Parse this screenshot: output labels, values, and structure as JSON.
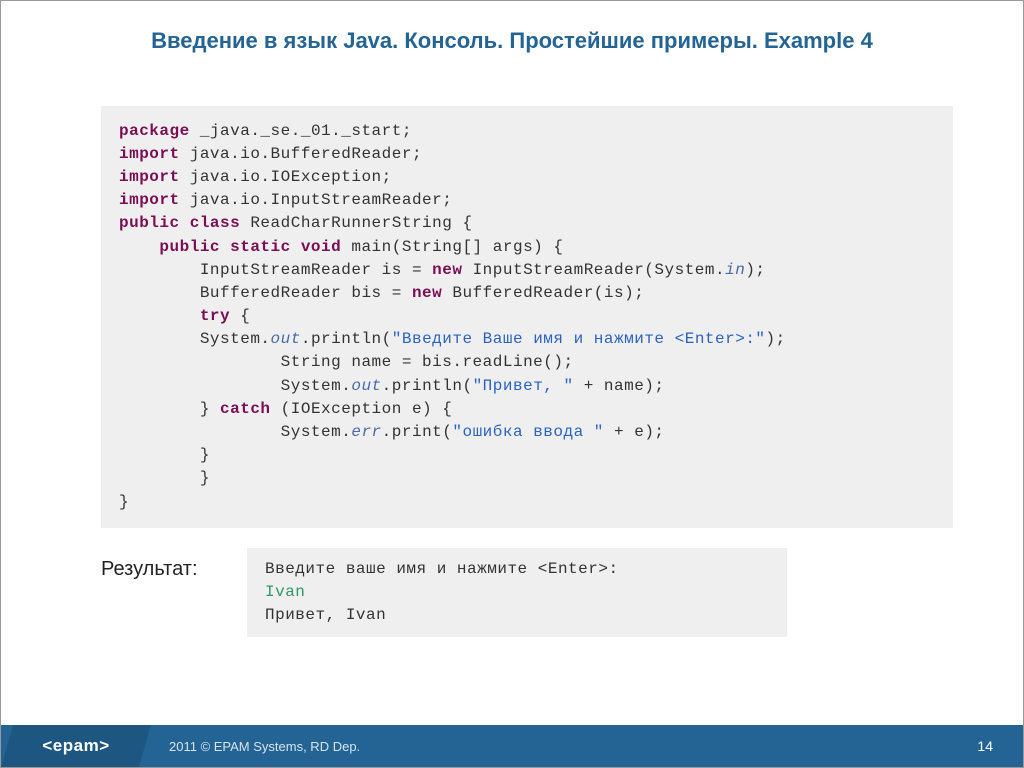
{
  "title": "Введение в язык Java. Консоль. Простейшие примеры. Example 4",
  "code": {
    "lines": [
      {
        "indent": 0,
        "tokens": [
          {
            "t": "package",
            "c": "kw"
          },
          {
            "t": " _java._se._01._start;"
          }
        ]
      },
      {
        "indent": 0,
        "tokens": [
          {
            "t": "import",
            "c": "kw"
          },
          {
            "t": " java.io.BufferedReader;"
          }
        ]
      },
      {
        "indent": 0,
        "tokens": [
          {
            "t": "import",
            "c": "kw"
          },
          {
            "t": " java.io.IOException;"
          }
        ]
      },
      {
        "indent": 0,
        "tokens": [
          {
            "t": "import",
            "c": "kw"
          },
          {
            "t": " java.io.InputStreamReader;"
          }
        ]
      },
      {
        "indent": 0,
        "tokens": [
          {
            "t": "public class",
            "c": "kw"
          },
          {
            "t": " ReadCharRunnerString {"
          }
        ]
      },
      {
        "indent": 1,
        "tokens": [
          {
            "t": "public static void",
            "c": "kw"
          },
          {
            "t": " main(String[] args) {"
          }
        ]
      },
      {
        "indent": 2,
        "tokens": [
          {
            "t": "InputStreamReader is = "
          },
          {
            "t": "new",
            "c": "kw"
          },
          {
            "t": " InputStreamReader(System."
          },
          {
            "t": "in",
            "c": "fld"
          },
          {
            "t": ");"
          }
        ]
      },
      {
        "indent": 2,
        "tokens": [
          {
            "t": "BufferedReader bis = "
          },
          {
            "t": "new",
            "c": "kw"
          },
          {
            "t": " BufferedReader(is);"
          }
        ]
      },
      {
        "indent": 2,
        "tokens": [
          {
            "t": "try",
            "c": "kw"
          },
          {
            "t": " {"
          }
        ]
      },
      {
        "indent": 2,
        "tokens": [
          {
            "t": "System."
          },
          {
            "t": "out",
            "c": "fld"
          },
          {
            "t": ".println("
          },
          {
            "t": "\"Введите Ваше имя и нажмите <Enter>:\"",
            "c": "lit"
          },
          {
            "t": ");"
          }
        ]
      },
      {
        "indent": 4,
        "tokens": [
          {
            "t": "String name = bis.readLine();"
          }
        ]
      },
      {
        "indent": 4,
        "tokens": [
          {
            "t": "System."
          },
          {
            "t": "out",
            "c": "fld"
          },
          {
            "t": ".println("
          },
          {
            "t": "\"Привет, \"",
            "c": "lit"
          },
          {
            "t": " + name);"
          }
        ]
      },
      {
        "indent": 2,
        "tokens": [
          {
            "t": "} "
          },
          {
            "t": "catch",
            "c": "kw"
          },
          {
            "t": " (IOException e) {"
          }
        ]
      },
      {
        "indent": 4,
        "tokens": [
          {
            "t": "System."
          },
          {
            "t": "err",
            "c": "fld"
          },
          {
            "t": ".print("
          },
          {
            "t": "\"ошибка ввода \"",
            "c": "lit"
          },
          {
            "t": " + e);"
          }
        ]
      },
      {
        "indent": 2,
        "tokens": [
          {
            "t": "}"
          }
        ]
      },
      {
        "indent": 2,
        "tokens": [
          {
            "t": "}"
          }
        ]
      },
      {
        "indent": 0,
        "tokens": [
          {
            "t": "}"
          }
        ]
      }
    ]
  },
  "result_label": "Результат:",
  "output": {
    "lines": [
      {
        "text": "Введите ваше имя и нажмите <Enter>:",
        "cls": ""
      },
      {
        "text": "Ivan",
        "cls": "user-in"
      },
      {
        "text": "Привет, Ivan",
        "cls": ""
      }
    ]
  },
  "footer": {
    "logo": "<epam>",
    "copyright": "2011 © EPAM Systems, RD Dep.",
    "page": "14"
  }
}
